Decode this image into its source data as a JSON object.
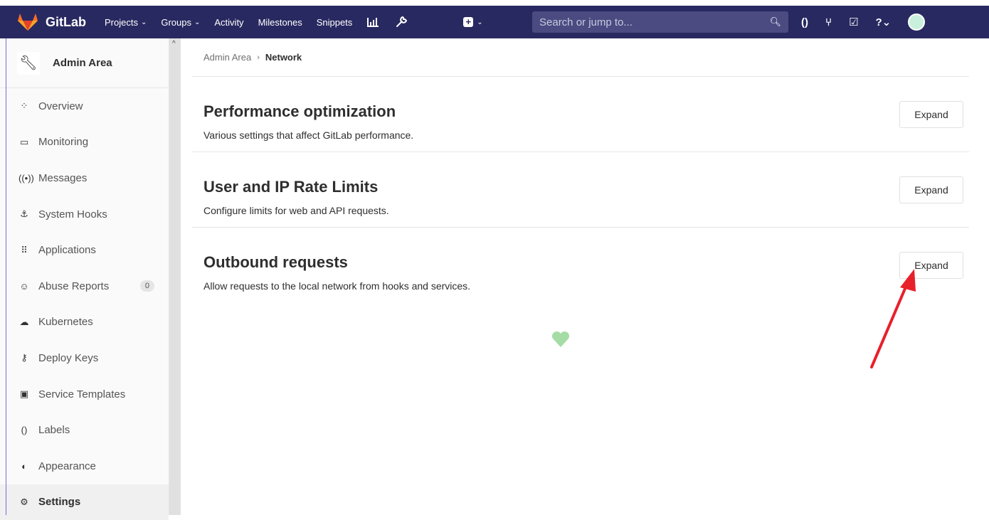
{
  "app": {
    "name": "GitLab"
  },
  "topnav": {
    "items": [
      {
        "label": "Projects",
        "dropdown": true
      },
      {
        "label": "Groups",
        "dropdown": true
      },
      {
        "label": "Activity",
        "dropdown": false
      },
      {
        "label": "Milestones",
        "dropdown": false
      },
      {
        "label": "Snippets",
        "dropdown": false
      }
    ],
    "icons": [
      "chart-bar-icon",
      "wrench-icon"
    ],
    "search_placeholder": "Search or jump to...",
    "right_icons": [
      "issues-icon",
      "merge-request-icon",
      "todo-icon",
      "help-icon"
    ]
  },
  "sidebar": {
    "title": "Admin Area",
    "items": [
      {
        "label": "Overview",
        "icon": "overview-icon",
        "glyph": "⁘"
      },
      {
        "label": "Monitoring",
        "icon": "monitor-icon",
        "glyph": "▭"
      },
      {
        "label": "Messages",
        "icon": "broadcast-icon",
        "glyph": "((•))"
      },
      {
        "label": "System Hooks",
        "icon": "hook-icon",
        "glyph": "⚓"
      },
      {
        "label": "Applications",
        "icon": "grid-icon",
        "glyph": "⠿"
      },
      {
        "label": "Abuse Reports",
        "icon": "smile-icon",
        "glyph": "☺",
        "badge": "0"
      },
      {
        "label": "Kubernetes",
        "icon": "cloud-icon",
        "glyph": "☁"
      },
      {
        "label": "Deploy Keys",
        "icon": "key-icon",
        "glyph": "⚷"
      },
      {
        "label": "Service Templates",
        "icon": "template-icon",
        "glyph": "▣"
      },
      {
        "label": "Labels",
        "icon": "labels-icon",
        "glyph": "()"
      },
      {
        "label": "Appearance",
        "icon": "palette-icon",
        "glyph": "◐"
      },
      {
        "label": "Settings",
        "icon": "gear-icon",
        "glyph": "⚙",
        "active": true
      }
    ]
  },
  "breadcrumb": {
    "parent": "Admin Area",
    "current": "Network"
  },
  "sections": [
    {
      "title": "Performance optimization",
      "description": "Various settings that affect GitLab performance.",
      "button": "Expand"
    },
    {
      "title": "User and IP Rate Limits",
      "description": "Configure limits for web and API requests.",
      "button": "Expand"
    },
    {
      "title": "Outbound requests",
      "description": "Allow requests to the local network from hooks and services.",
      "button": "Expand"
    }
  ],
  "colors": {
    "navbar": "#292961",
    "accent_arrow": "#e8202a",
    "heart": "#a5dca5"
  }
}
